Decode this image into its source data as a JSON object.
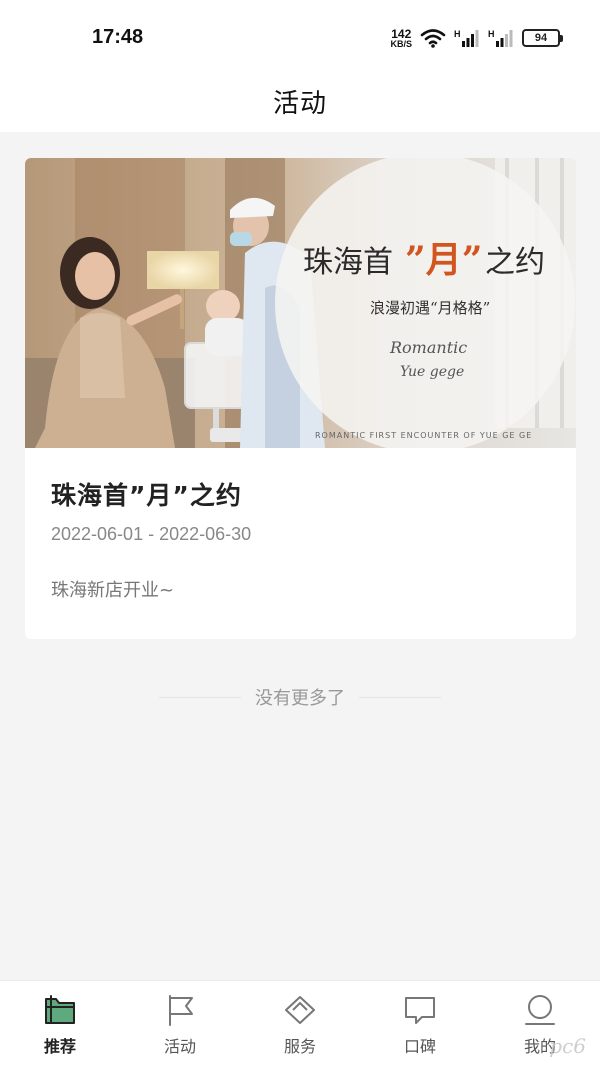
{
  "status_bar": {
    "time": "17:48",
    "net_speed_value": "142",
    "net_speed_unit": "KB/S",
    "signal_label": "H",
    "battery": "94"
  },
  "header": {
    "title": "活动"
  },
  "activity": {
    "title": "珠海首”月”之约",
    "date_range": "2022-06-01 - 2022-06-30",
    "description": "珠海新店开业~",
    "banner": {
      "headline_prefix": "珠海首",
      "headline_accent": "”月”",
      "headline_suffix": "之约",
      "subtitle": "浪漫初遇“月格格”",
      "signature": "Romantic",
      "signature_sub": "Yue gege",
      "english_line": "ROMANTIC FIRST ENCOUNTER OF YUE GE GE",
      "accent_color": "#d2541e"
    }
  },
  "footer_note": "没有更多了",
  "nav": {
    "items": [
      {
        "label": "推荐",
        "icon": "folder-icon",
        "active": true
      },
      {
        "label": "活动",
        "icon": "flag-icon",
        "active": false
      },
      {
        "label": "服务",
        "icon": "diamond-icon",
        "active": false
      },
      {
        "label": "口碑",
        "icon": "chat-bubble-icon",
        "active": false
      },
      {
        "label": "我的",
        "icon": "person-icon",
        "active": false
      }
    ],
    "active_color": "#5fa97e"
  },
  "watermark": "pc6"
}
